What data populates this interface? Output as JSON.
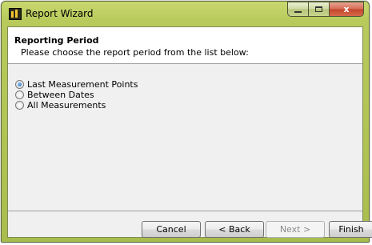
{
  "window": {
    "title": "Report Wizard",
    "app_icon": "report-wizard-app-icon",
    "caption_buttons": {
      "close_symbol": "x"
    }
  },
  "header": {
    "title": "Reporting Period",
    "subtitle": "Please choose the report period from the list below:"
  },
  "options": [
    {
      "label": "Last Measurement Points",
      "selected": true
    },
    {
      "label": "Between Dates",
      "selected": false
    },
    {
      "label": "All Measurements",
      "selected": false
    }
  ],
  "buttons": {
    "cancel": "Cancel",
    "back": "< Back",
    "next": "Next >",
    "finish": "Finish"
  },
  "colors": {
    "frame_accent": "#b8ca5c",
    "selected_radio": "#1b5fb0"
  }
}
